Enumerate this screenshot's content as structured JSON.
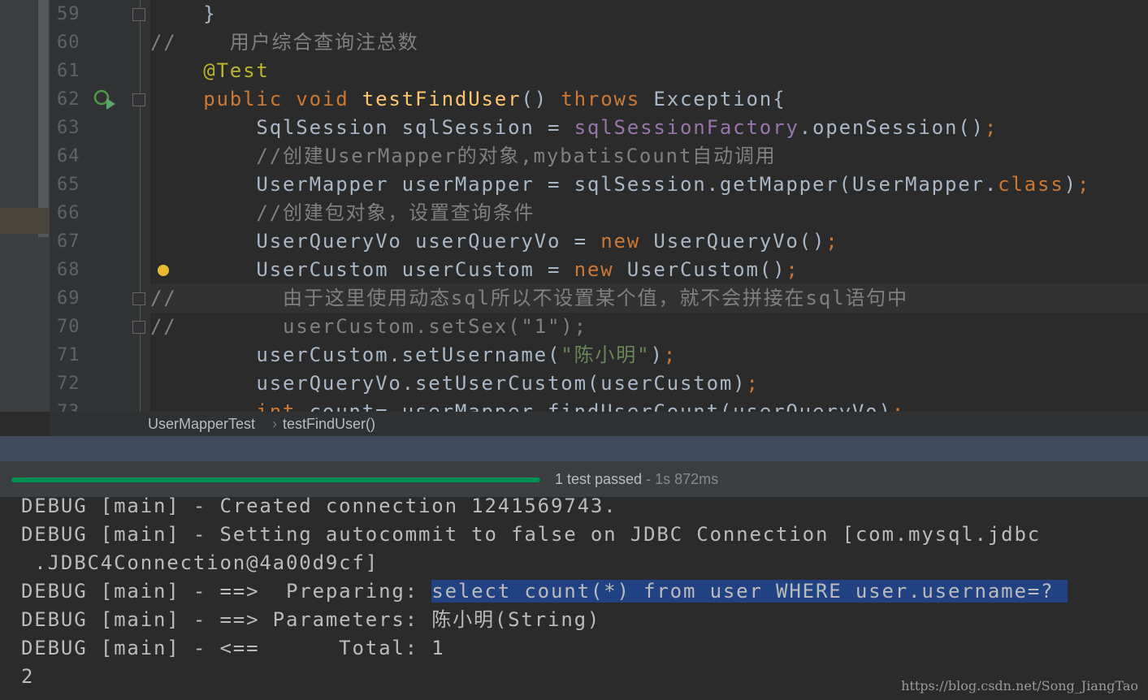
{
  "editor": {
    "lines": [
      {
        "n": "59",
        "tokens": [
          [
            "    }",
            "tx"
          ]
        ]
      },
      {
        "n": "60",
        "tokens": [
          [
            "//    用户综合查询注总数",
            "cm"
          ]
        ]
      },
      {
        "n": "61",
        "tokens": [
          [
            "    ",
            "tx"
          ],
          [
            "@Test",
            "an"
          ]
        ]
      },
      {
        "n": "62",
        "tokens": [
          [
            "    ",
            "tx"
          ],
          [
            "public void ",
            "kw"
          ],
          [
            "testFindUser",
            "fn"
          ],
          [
            "() ",
            "tx"
          ],
          [
            "throws ",
            "kw"
          ],
          [
            "Exception{",
            "tx"
          ]
        ]
      },
      {
        "n": "63",
        "tokens": [
          [
            "        SqlSession sqlSession = ",
            "tx"
          ],
          [
            "sqlSessionFactory",
            "fd"
          ],
          [
            ".openSession()",
            "tx"
          ],
          [
            ";",
            "kw"
          ]
        ]
      },
      {
        "n": "64",
        "tokens": [
          [
            "        //创建UserMapper的对象,mybatisCount自动调用",
            "cm"
          ]
        ]
      },
      {
        "n": "65",
        "tokens": [
          [
            "        UserMapper userMapper = sqlSession.getMapper(UserMapper.",
            "tx"
          ],
          [
            "class",
            "kw"
          ],
          [
            ")",
            "tx"
          ],
          [
            ";",
            "kw"
          ]
        ]
      },
      {
        "n": "66",
        "tokens": [
          [
            "        //创建包对象，设置查询条件",
            "cm"
          ]
        ]
      },
      {
        "n": "67",
        "tokens": [
          [
            "        UserQueryVo userQueryVo = ",
            "tx"
          ],
          [
            "new ",
            "kw"
          ],
          [
            "UserQueryVo()",
            "tx"
          ],
          [
            ";",
            "kw"
          ]
        ]
      },
      {
        "n": "68",
        "tokens": [
          [
            "        UserCustom userCustom = ",
            "tx"
          ],
          [
            "new ",
            "kw"
          ],
          [
            "UserCustom()",
            "tx"
          ],
          [
            ";",
            "kw"
          ]
        ]
      },
      {
        "n": "69",
        "tokens": [
          [
            "//        由于这里使用动态sql所以不设置某个值，就不会拼接在sql语句中",
            "cm"
          ]
        ]
      },
      {
        "n": "70",
        "tokens": [
          [
            "//        userCustom.setSex(\"1\");",
            "cm"
          ]
        ]
      },
      {
        "n": "71",
        "tokens": [
          [
            "        userCustom.setUsername(",
            "tx"
          ],
          [
            "\"陈小明\"",
            "st"
          ],
          [
            ")",
            "tx"
          ],
          [
            ";",
            "kw"
          ]
        ]
      },
      {
        "n": "72",
        "tokens": [
          [
            "        userQueryVo.setUserCustom(userCustom)",
            "tx"
          ],
          [
            ";",
            "kw"
          ]
        ]
      },
      {
        "n": "73",
        "tokens": [
          [
            "        ",
            "tx"
          ],
          [
            "int ",
            "kw"
          ],
          [
            "count= userMapper.findUserCount(userQueryVo)",
            "tx"
          ],
          [
            ";",
            "kw"
          ]
        ]
      }
    ]
  },
  "breadcrumb": {
    "items": [
      "UserMapperTest",
      "testFindUser()"
    ],
    "separator": "›"
  },
  "test": {
    "status": "1 test passed",
    "time": "- 1s 872ms",
    "progress": 100,
    "color": "#008f52"
  },
  "console": {
    "lines": [
      {
        "text": "DEBUG [main] - Created connection 1241569743."
      },
      {
        "text": "DEBUG [main] - Setting autocommit to false on JDBC Connection [com.mysql.jdbc"
      },
      {
        "text": " .JDBC4Connection@4a00d9cf]"
      },
      {
        "text": "DEBUG [main] - ==>  Preparing: ",
        "sel": "select count(*) from user WHERE user.username=? "
      },
      {
        "text": "DEBUG [main] - ==> Parameters: 陈小明(String)"
      },
      {
        "text": "DEBUG [main] - <==      Total: 1"
      },
      {
        "text": "2"
      }
    ]
  },
  "watermark": "https://blog.csdn.net/Song_JiangTao"
}
